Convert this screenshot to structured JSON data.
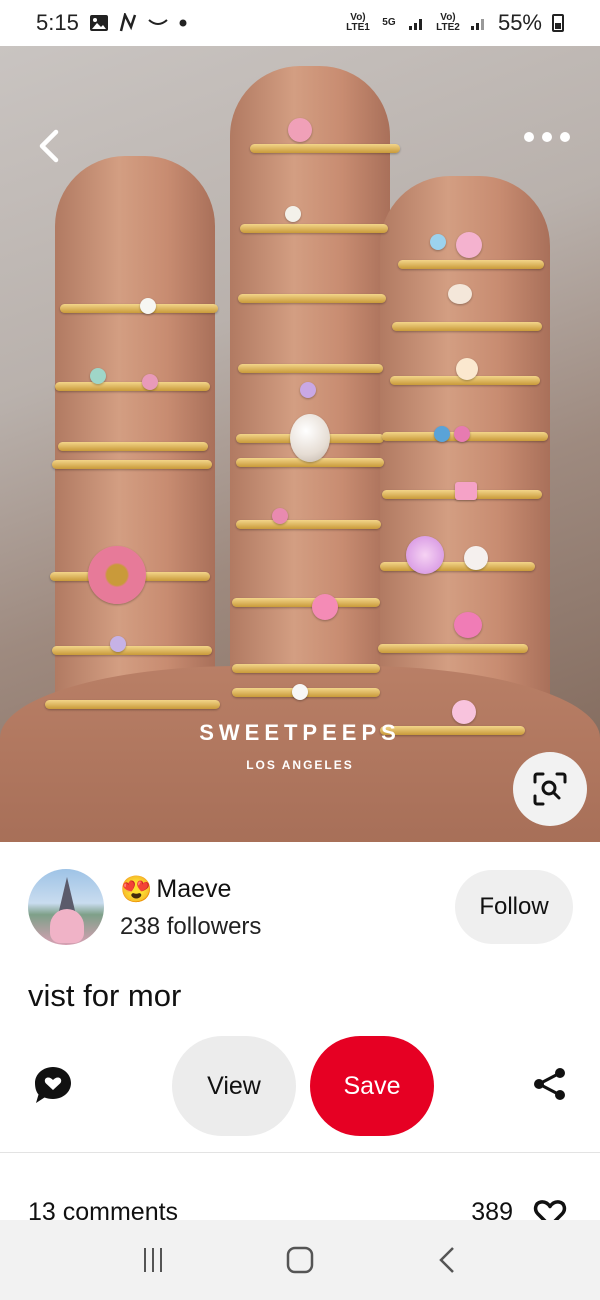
{
  "status_bar": {
    "time": "5:15",
    "notification_icons": [
      "image-icon",
      "n-icon",
      "amazon-icon",
      "dot-icon"
    ],
    "network_1": "Vo) LTE1",
    "network_5g": "5G",
    "network_2": "Vo) LTE2",
    "battery": "55%"
  },
  "hero": {
    "brand_watermark": "SWEETPEEPS",
    "brand_location": "LOS ANGELES"
  },
  "creator": {
    "emoji": "😍",
    "name": "Maeve",
    "followers": "238 followers",
    "follow_label": "Follow"
  },
  "pin": {
    "description": "vist for mor"
  },
  "actions": {
    "view_label": "View",
    "save_label": "Save",
    "save_color": "#e60023"
  },
  "engagement": {
    "comments": "13 comments",
    "likes": "389"
  },
  "icons": {
    "top_left": "back-chevron-icon",
    "top_right": "more-dots-icon",
    "lens": "visual-search-icon",
    "comment": "comment-bubble-heart-icon",
    "share": "share-icon",
    "like": "heart-outline-icon"
  }
}
